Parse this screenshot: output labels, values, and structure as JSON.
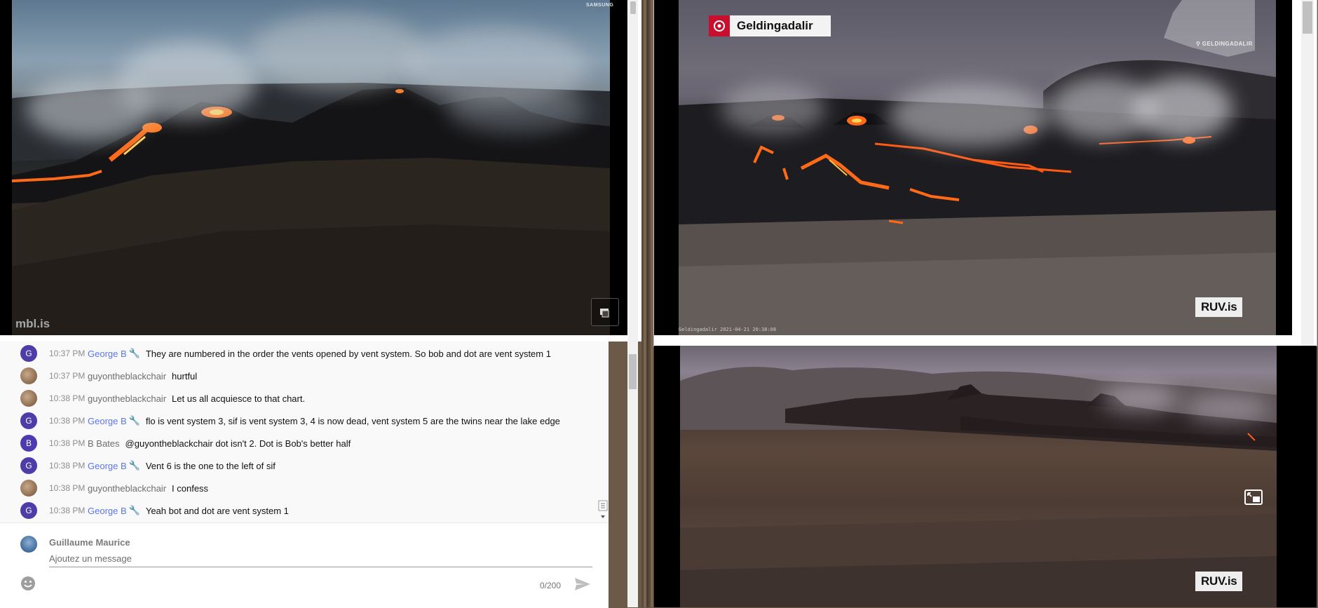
{
  "left_video": {
    "watermark": "mbl.is",
    "camera_brand": "SAMSUNG",
    "button_icon": "camera-switch-icon"
  },
  "chat": {
    "messages": [
      {
        "time": "10:37 PM",
        "author": "George B",
        "avatar": "G",
        "moderator": true,
        "text": "They are numbered in the order the vents opened by vent system. So bob and dot are vent system 1"
      },
      {
        "time": "10:37 PM",
        "author": "guyontheblackchair",
        "avatar": "",
        "moderator": false,
        "text": "hurtful"
      },
      {
        "time": "10:38 PM",
        "author": "guyontheblackchair",
        "avatar": "",
        "moderator": false,
        "text": "Let us all acquiesce to that chart."
      },
      {
        "time": "10:38 PM",
        "author": "George B",
        "avatar": "G",
        "moderator": true,
        "text": "flo is vent system 3, sif is vent system 3, 4 is now dead, vent system 5 are the twins near the lake edge"
      },
      {
        "time": "10:38 PM",
        "author": "B Bates",
        "avatar": "B",
        "moderator": false,
        "text": "@guyontheblackchair dot isn't 2. Dot is Bob's better half"
      },
      {
        "time": "10:38 PM",
        "author": "George B",
        "avatar": "G",
        "moderator": true,
        "text": "Vent 6 is the one to the left of sif"
      },
      {
        "time": "10:38 PM",
        "author": "guyontheblackchair",
        "avatar": "",
        "moderator": false,
        "text": "I confess"
      },
      {
        "time": "10:38 PM",
        "author": "George B",
        "avatar": "G",
        "moderator": true,
        "text": "Yeah bot and dot are vent system 1"
      }
    ],
    "current_user": "Guillaume Maurice",
    "input_placeholder": "Ajoutez un message",
    "char_count": "0/200",
    "colors": {
      "moderator": "#5a78e6",
      "avatar_g": "#4d3da8"
    }
  },
  "right_top_video": {
    "brand_label": "Geldingadalir",
    "map_label": "GELDINGADALIR",
    "badge": "RUV.is",
    "stamp": "Geldingadalir 2021-04-21 20:38:08"
  },
  "right_bottom_video": {
    "badge": "RUV.is",
    "button_icon": "picture-in-picture-icon"
  }
}
